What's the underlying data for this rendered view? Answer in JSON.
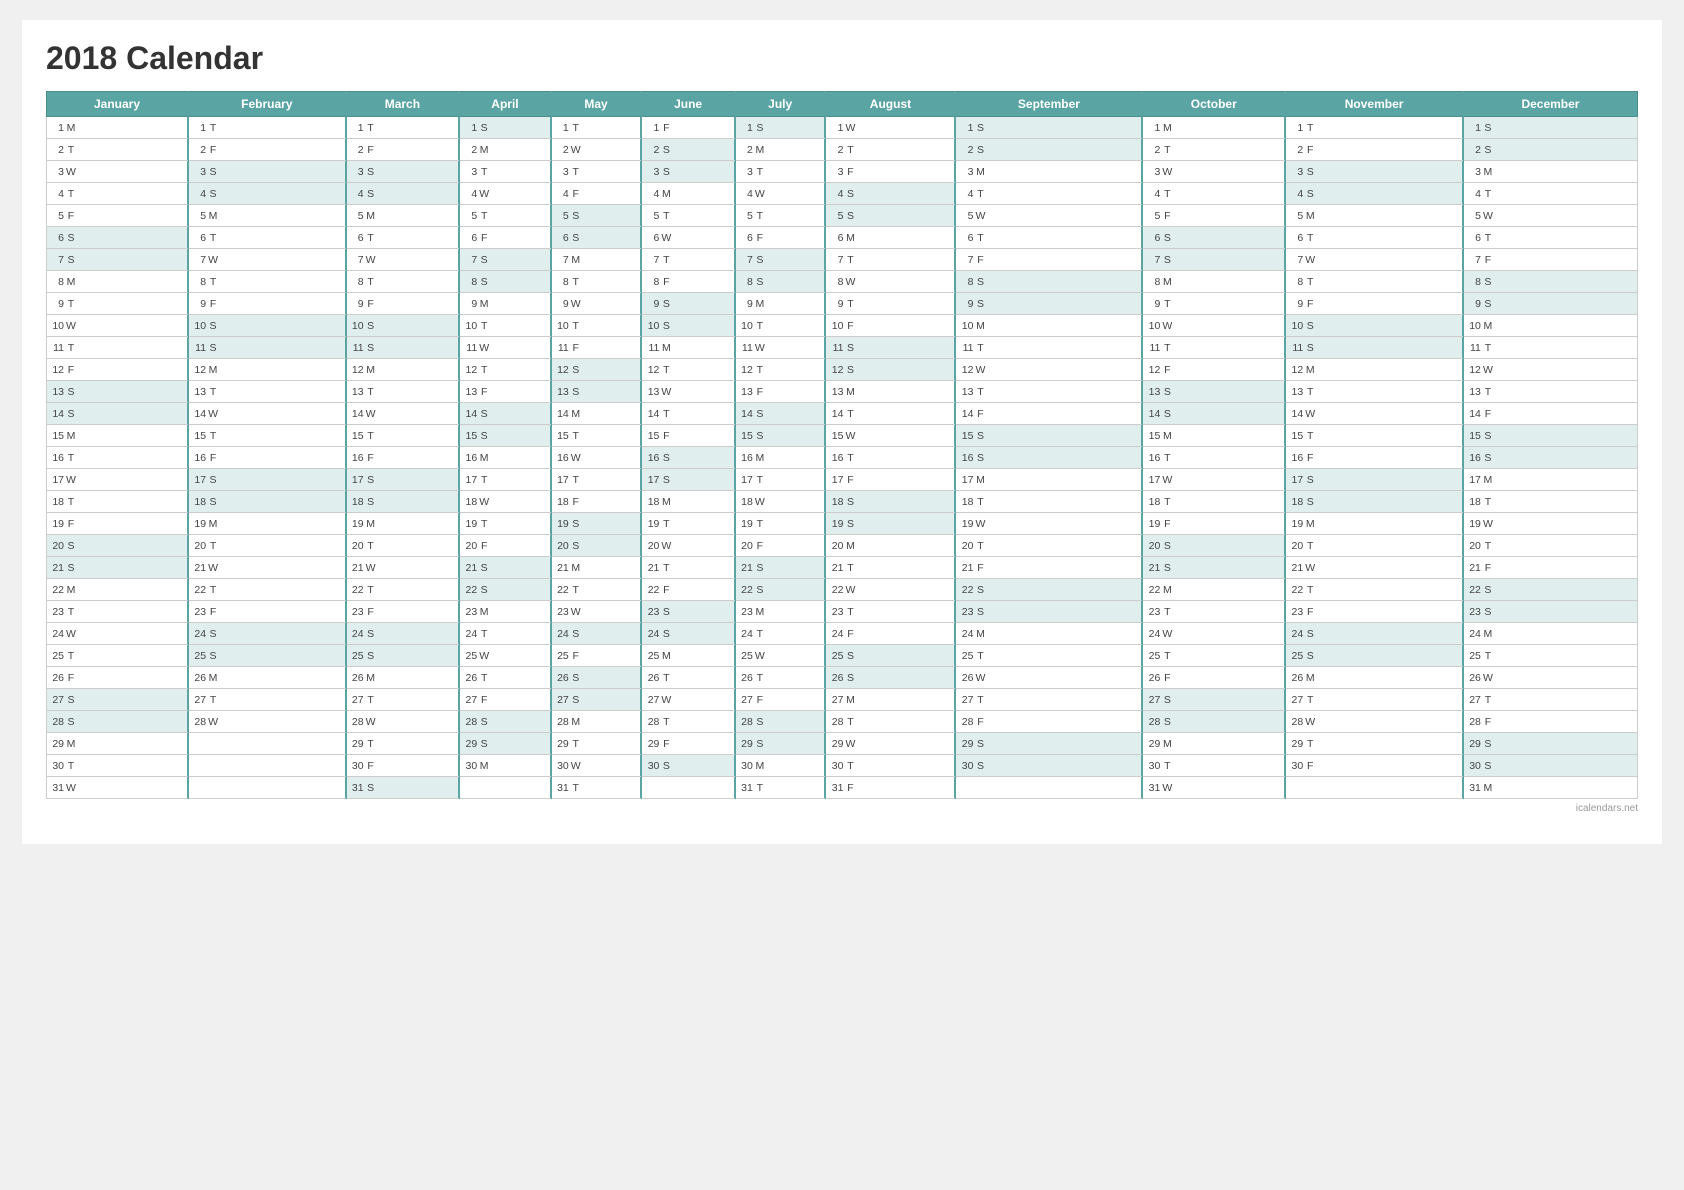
{
  "title": "2018 Calendar",
  "months": [
    "January",
    "February",
    "March",
    "April",
    "May",
    "June",
    "July",
    "August",
    "September",
    "October",
    "November",
    "December"
  ],
  "footer": "icalendars.net",
  "days": {
    "january": [
      "1,M",
      "2,T",
      "3,W",
      "4,T",
      "5,F",
      "6,S",
      "7,S",
      "8,M",
      "9,T",
      "10,W",
      "11,T",
      "12,F",
      "13,S",
      "14,S",
      "15,M",
      "16,T",
      "17,W",
      "18,T",
      "19,F",
      "20,S",
      "21,S",
      "22,M",
      "23,T",
      "24,W",
      "25,T",
      "26,F",
      "27,S",
      "28,S",
      "29,M",
      "30,T",
      "31,W"
    ],
    "february": [
      "1,T",
      "2,F",
      "3,S",
      "4,S",
      "5,M",
      "6,T",
      "7,W",
      "8,T",
      "9,F",
      "10,S",
      "11,S",
      "12,M",
      "13,T",
      "14,W",
      "15,T",
      "16,F",
      "17,S",
      "18,S",
      "19,M",
      "20,T",
      "21,W",
      "22,T",
      "23,F",
      "24,S",
      "25,S",
      "26,M",
      "27,T",
      "28,W"
    ],
    "march": [
      "1,T",
      "2,F",
      "3,S",
      "4,S",
      "5,M",
      "6,T",
      "7,W",
      "8,T",
      "9,F",
      "10,S",
      "11,S",
      "12,M",
      "13,T",
      "14,W",
      "15,T",
      "16,F",
      "17,S",
      "18,S",
      "19,M",
      "20,T",
      "21,W",
      "22,T",
      "23,F",
      "24,S",
      "25,S",
      "26,M",
      "27,T",
      "28,W",
      "29,T",
      "30,F",
      "31,S"
    ],
    "april": [
      "1,S",
      "2,M",
      "3,T",
      "4,W",
      "5,T",
      "6,F",
      "7,S",
      "8,S",
      "9,M",
      "10,T",
      "11,W",
      "12,T",
      "13,F",
      "14,S",
      "15,S",
      "16,M",
      "17,T",
      "18,W",
      "19,T",
      "20,F",
      "21,S",
      "22,S",
      "23,M",
      "24,T",
      "25,W",
      "26,T",
      "27,F",
      "28,S",
      "29,S",
      "30,M"
    ],
    "may": [
      "1,T",
      "2,W",
      "3,T",
      "4,F",
      "5,S",
      "6,S",
      "7,M",
      "8,T",
      "9,W",
      "10,T",
      "11,F",
      "12,S",
      "13,S",
      "14,M",
      "15,T",
      "16,W",
      "17,T",
      "18,F",
      "19,S",
      "20,S",
      "21,M",
      "22,T",
      "23,W",
      "24,S",
      "25,F",
      "26,S",
      "27,S",
      "28,M",
      "29,T",
      "30,W",
      "31,T"
    ],
    "june": [
      "1,F",
      "2,S",
      "3,S",
      "4,M",
      "5,T",
      "6,W",
      "7,T",
      "8,F",
      "9,S",
      "10,S",
      "11,M",
      "12,T",
      "13,W",
      "14,T",
      "15,F",
      "16,S",
      "17,S",
      "18,M",
      "19,T",
      "20,W",
      "21,T",
      "22,F",
      "23,S",
      "24,S",
      "25,M",
      "26,T",
      "27,W",
      "28,T",
      "29,F",
      "30,S"
    ],
    "july": [
      "1,S",
      "2,M",
      "3,T",
      "4,W",
      "5,T",
      "6,F",
      "7,S",
      "8,S",
      "9,M",
      "10,T",
      "11,W",
      "12,T",
      "13,F",
      "14,S",
      "15,S",
      "16,M",
      "17,T",
      "18,W",
      "19,T",
      "20,F",
      "21,S",
      "22,S",
      "23,M",
      "24,T",
      "25,W",
      "26,T",
      "27,F",
      "28,S",
      "29,S",
      "30,M",
      "31,T"
    ],
    "august": [
      "1,W",
      "2,T",
      "3,F",
      "4,S",
      "5,S",
      "6,M",
      "7,T",
      "8,W",
      "9,T",
      "10,F",
      "11,S",
      "12,S",
      "13,M",
      "14,T",
      "15,W",
      "16,T",
      "17,F",
      "18,S",
      "19,S",
      "20,M",
      "21,T",
      "22,W",
      "23,T",
      "24,F",
      "25,S",
      "26,S",
      "27,M",
      "28,T",
      "29,W",
      "30,T",
      "31,F"
    ],
    "september": [
      "1,S",
      "2,S",
      "3,M",
      "4,T",
      "5,W",
      "6,T",
      "7,F",
      "8,S",
      "9,S",
      "10,M",
      "11,T",
      "12,W",
      "13,T",
      "14,F",
      "15,S",
      "16,S",
      "17,M",
      "18,T",
      "19,W",
      "20,T",
      "21,F",
      "22,S",
      "23,S",
      "24,M",
      "25,T",
      "26,W",
      "27,T",
      "28,F",
      "29,S",
      "30,S"
    ],
    "october": [
      "1,M",
      "2,T",
      "3,W",
      "4,T",
      "5,F",
      "6,S",
      "7,S",
      "8,M",
      "9,T",
      "10,W",
      "11,T",
      "12,F",
      "13,S",
      "14,S",
      "15,M",
      "16,T",
      "17,W",
      "18,T",
      "19,F",
      "20,S",
      "21,S",
      "22,M",
      "23,T",
      "24,W",
      "25,T",
      "26,F",
      "27,S",
      "28,S",
      "29,M",
      "30,T",
      "31,W"
    ],
    "november": [
      "1,T",
      "2,F",
      "3,S",
      "4,S",
      "5,M",
      "6,T",
      "7,W",
      "8,T",
      "9,F",
      "10,S",
      "11,S",
      "12,M",
      "13,T",
      "14,W",
      "15,T",
      "16,F",
      "17,S",
      "18,S",
      "19,M",
      "20,T",
      "21,W",
      "22,T",
      "23,F",
      "24,S",
      "25,S",
      "26,M",
      "27,T",
      "28,W",
      "29,T",
      "30,F"
    ],
    "december": [
      "1,S",
      "2,S",
      "3,M",
      "4,T",
      "5,W",
      "6,T",
      "7,F",
      "8,S",
      "9,S",
      "10,M",
      "11,T",
      "12,W",
      "13,T",
      "14,F",
      "15,S",
      "16,S",
      "17,M",
      "18,T",
      "19,W",
      "20,T",
      "21,F",
      "22,S",
      "23,S",
      "24,M",
      "25,T",
      "26,W",
      "27,T",
      "28,F",
      "29,S",
      "30,S",
      "31,M"
    ]
  }
}
